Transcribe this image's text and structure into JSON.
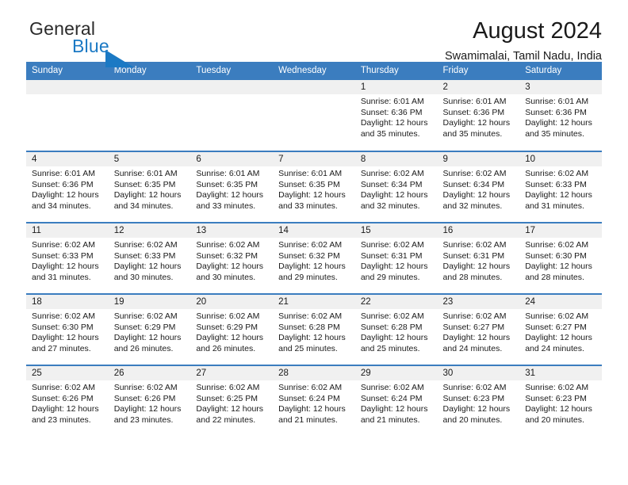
{
  "brand": {
    "name_part1": "General",
    "name_part2": "Blue",
    "mark": "triangle-icon",
    "accent_color": "#1b79c4"
  },
  "header": {
    "title": "August 2024",
    "subtitle": "Swamimalai, Tamil Nadu, India"
  },
  "calendar": {
    "header_bg": "#3b7dbf",
    "daynum_bg": "#f0f0f0",
    "weekdays": [
      "Sunday",
      "Monday",
      "Tuesday",
      "Wednesday",
      "Thursday",
      "Friday",
      "Saturday"
    ],
    "weeks": [
      [
        {
          "day": "",
          "empty": true
        },
        {
          "day": "",
          "empty": true
        },
        {
          "day": "",
          "empty": true
        },
        {
          "day": "",
          "empty": true
        },
        {
          "day": "1",
          "sunrise": "Sunrise: 6:01 AM",
          "sunset": "Sunset: 6:36 PM",
          "daylight": "Daylight: 12 hours and 35 minutes."
        },
        {
          "day": "2",
          "sunrise": "Sunrise: 6:01 AM",
          "sunset": "Sunset: 6:36 PM",
          "daylight": "Daylight: 12 hours and 35 minutes."
        },
        {
          "day": "3",
          "sunrise": "Sunrise: 6:01 AM",
          "sunset": "Sunset: 6:36 PM",
          "daylight": "Daylight: 12 hours and 35 minutes."
        }
      ],
      [
        {
          "day": "4",
          "sunrise": "Sunrise: 6:01 AM",
          "sunset": "Sunset: 6:36 PM",
          "daylight": "Daylight: 12 hours and 34 minutes."
        },
        {
          "day": "5",
          "sunrise": "Sunrise: 6:01 AM",
          "sunset": "Sunset: 6:35 PM",
          "daylight": "Daylight: 12 hours and 34 minutes."
        },
        {
          "day": "6",
          "sunrise": "Sunrise: 6:01 AM",
          "sunset": "Sunset: 6:35 PM",
          "daylight": "Daylight: 12 hours and 33 minutes."
        },
        {
          "day": "7",
          "sunrise": "Sunrise: 6:01 AM",
          "sunset": "Sunset: 6:35 PM",
          "daylight": "Daylight: 12 hours and 33 minutes."
        },
        {
          "day": "8",
          "sunrise": "Sunrise: 6:02 AM",
          "sunset": "Sunset: 6:34 PM",
          "daylight": "Daylight: 12 hours and 32 minutes."
        },
        {
          "day": "9",
          "sunrise": "Sunrise: 6:02 AM",
          "sunset": "Sunset: 6:34 PM",
          "daylight": "Daylight: 12 hours and 32 minutes."
        },
        {
          "day": "10",
          "sunrise": "Sunrise: 6:02 AM",
          "sunset": "Sunset: 6:33 PM",
          "daylight": "Daylight: 12 hours and 31 minutes."
        }
      ],
      [
        {
          "day": "11",
          "sunrise": "Sunrise: 6:02 AM",
          "sunset": "Sunset: 6:33 PM",
          "daylight": "Daylight: 12 hours and 31 minutes."
        },
        {
          "day": "12",
          "sunrise": "Sunrise: 6:02 AM",
          "sunset": "Sunset: 6:33 PM",
          "daylight": "Daylight: 12 hours and 30 minutes."
        },
        {
          "day": "13",
          "sunrise": "Sunrise: 6:02 AM",
          "sunset": "Sunset: 6:32 PM",
          "daylight": "Daylight: 12 hours and 30 minutes."
        },
        {
          "day": "14",
          "sunrise": "Sunrise: 6:02 AM",
          "sunset": "Sunset: 6:32 PM",
          "daylight": "Daylight: 12 hours and 29 minutes."
        },
        {
          "day": "15",
          "sunrise": "Sunrise: 6:02 AM",
          "sunset": "Sunset: 6:31 PM",
          "daylight": "Daylight: 12 hours and 29 minutes."
        },
        {
          "day": "16",
          "sunrise": "Sunrise: 6:02 AM",
          "sunset": "Sunset: 6:31 PM",
          "daylight": "Daylight: 12 hours and 28 minutes."
        },
        {
          "day": "17",
          "sunrise": "Sunrise: 6:02 AM",
          "sunset": "Sunset: 6:30 PM",
          "daylight": "Daylight: 12 hours and 28 minutes."
        }
      ],
      [
        {
          "day": "18",
          "sunrise": "Sunrise: 6:02 AM",
          "sunset": "Sunset: 6:30 PM",
          "daylight": "Daylight: 12 hours and 27 minutes."
        },
        {
          "day": "19",
          "sunrise": "Sunrise: 6:02 AM",
          "sunset": "Sunset: 6:29 PM",
          "daylight": "Daylight: 12 hours and 26 minutes."
        },
        {
          "day": "20",
          "sunrise": "Sunrise: 6:02 AM",
          "sunset": "Sunset: 6:29 PM",
          "daylight": "Daylight: 12 hours and 26 minutes."
        },
        {
          "day": "21",
          "sunrise": "Sunrise: 6:02 AM",
          "sunset": "Sunset: 6:28 PM",
          "daylight": "Daylight: 12 hours and 25 minutes."
        },
        {
          "day": "22",
          "sunrise": "Sunrise: 6:02 AM",
          "sunset": "Sunset: 6:28 PM",
          "daylight": "Daylight: 12 hours and 25 minutes."
        },
        {
          "day": "23",
          "sunrise": "Sunrise: 6:02 AM",
          "sunset": "Sunset: 6:27 PM",
          "daylight": "Daylight: 12 hours and 24 minutes."
        },
        {
          "day": "24",
          "sunrise": "Sunrise: 6:02 AM",
          "sunset": "Sunset: 6:27 PM",
          "daylight": "Daylight: 12 hours and 24 minutes."
        }
      ],
      [
        {
          "day": "25",
          "sunrise": "Sunrise: 6:02 AM",
          "sunset": "Sunset: 6:26 PM",
          "daylight": "Daylight: 12 hours and 23 minutes."
        },
        {
          "day": "26",
          "sunrise": "Sunrise: 6:02 AM",
          "sunset": "Sunset: 6:26 PM",
          "daylight": "Daylight: 12 hours and 23 minutes."
        },
        {
          "day": "27",
          "sunrise": "Sunrise: 6:02 AM",
          "sunset": "Sunset: 6:25 PM",
          "daylight": "Daylight: 12 hours and 22 minutes."
        },
        {
          "day": "28",
          "sunrise": "Sunrise: 6:02 AM",
          "sunset": "Sunset: 6:24 PM",
          "daylight": "Daylight: 12 hours and 21 minutes."
        },
        {
          "day": "29",
          "sunrise": "Sunrise: 6:02 AM",
          "sunset": "Sunset: 6:24 PM",
          "daylight": "Daylight: 12 hours and 21 minutes."
        },
        {
          "day": "30",
          "sunrise": "Sunrise: 6:02 AM",
          "sunset": "Sunset: 6:23 PM",
          "daylight": "Daylight: 12 hours and 20 minutes."
        },
        {
          "day": "31",
          "sunrise": "Sunrise: 6:02 AM",
          "sunset": "Sunset: 6:23 PM",
          "daylight": "Daylight: 12 hours and 20 minutes."
        }
      ]
    ]
  }
}
